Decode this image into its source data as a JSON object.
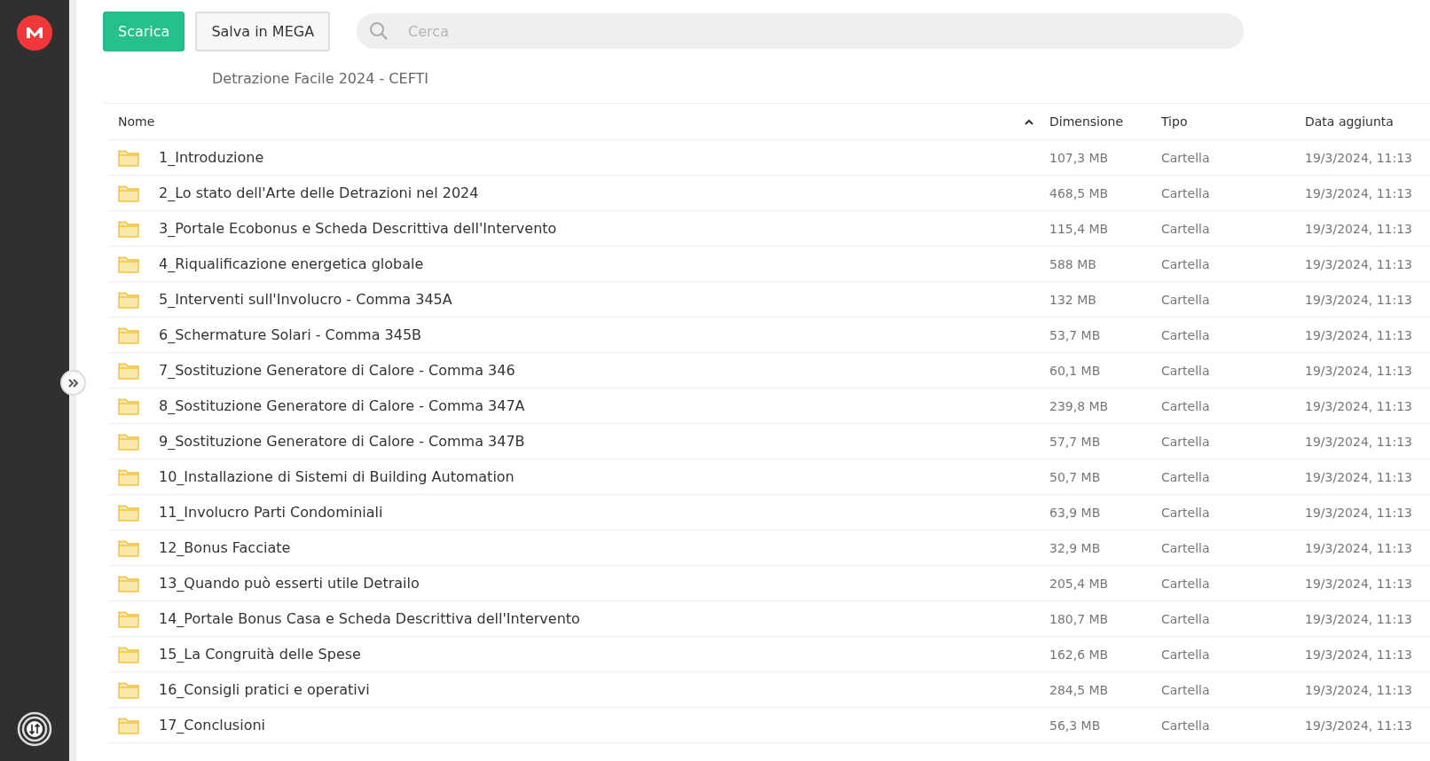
{
  "toolbar": {
    "buttons": [
      {
        "label": "Scarica",
        "kind": "primary"
      },
      {
        "label": "Salva in MEGA",
        "kind": "secondary"
      }
    ],
    "search": {
      "placeholder": "Cerca"
    }
  },
  "breadcrumb": "Detrazione Facile 2024 - CEFTI",
  "table": {
    "columns": [
      "Nome",
      "Dimensione",
      "Tipo",
      "Data aggiunta"
    ],
    "rows": [
      {
        "name": "1_Introduzione",
        "size": "107,3 MB",
        "type": "Cartella",
        "date": "19/3/2024, 11:13"
      },
      {
        "name": "2_Lo stato dell'Arte delle Detrazioni nel 2024",
        "size": "468,5 MB",
        "type": "Cartella",
        "date": "19/3/2024, 11:13"
      },
      {
        "name": "3_Portale Ecobonus e Scheda Descrittiva dell'Intervento",
        "size": "115,4 MB",
        "type": "Cartella",
        "date": "19/3/2024, 11:13"
      },
      {
        "name": "4_Riqualificazione energetica globale",
        "size": "588 MB",
        "type": "Cartella",
        "date": "19/3/2024, 11:13"
      },
      {
        "name": "5_Interventi sull'Involucro - Comma 345A",
        "size": "132 MB",
        "type": "Cartella",
        "date": "19/3/2024, 11:13"
      },
      {
        "name": "6_Schermature Solari - Comma 345B",
        "size": "53,7 MB",
        "type": "Cartella",
        "date": "19/3/2024, 11:13"
      },
      {
        "name": "7_Sostituzione Generatore di Calore - Comma 346",
        "size": "60,1 MB",
        "type": "Cartella",
        "date": "19/3/2024, 11:13"
      },
      {
        "name": "8_Sostituzione Generatore di Calore - Comma 347A",
        "size": "239,8 MB",
        "type": "Cartella",
        "date": "19/3/2024, 11:13"
      },
      {
        "name": "9_Sostituzione Generatore di Calore - Comma 347B",
        "size": "57,7 MB",
        "type": "Cartella",
        "date": "19/3/2024, 11:13"
      },
      {
        "name": "10_Installazione di Sistemi di Building Automation",
        "size": "50,7 MB",
        "type": "Cartella",
        "date": "19/3/2024, 11:13"
      },
      {
        "name": "11_Involucro Parti Condominiali",
        "size": "63,9 MB",
        "type": "Cartella",
        "date": "19/3/2024, 11:13"
      },
      {
        "name": "12_Bonus Facciate",
        "size": "32,9 MB",
        "type": "Cartella",
        "date": "19/3/2024, 11:13"
      },
      {
        "name": "13_Quando può esserti utile Detrailo",
        "size": "205,4 MB",
        "type": "Cartella",
        "date": "19/3/2024, 11:13"
      },
      {
        "name": "14_Portale Bonus Casa e Scheda Descrittiva dell'Intervento",
        "size": "180,7 MB",
        "type": "Cartella",
        "date": "19/3/2024, 11:13"
      },
      {
        "name": "15_La Congruità delle Spese",
        "size": "162,6 MB",
        "type": "Cartella",
        "date": "19/3/2024, 11:13"
      },
      {
        "name": "16_Consigli pratici e operativi",
        "size": "284,5 MB",
        "type": "Cartella",
        "date": "19/3/2024, 11:13"
      },
      {
        "name": "17_Conclusioni",
        "size": "56,3 MB",
        "type": "Cartella",
        "date": "19/3/2024, 11:13"
      }
    ]
  }
}
